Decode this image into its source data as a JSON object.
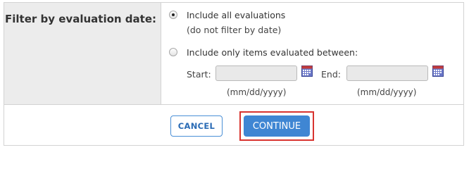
{
  "filter": {
    "label": "Filter by evaluation date:",
    "option_all": {
      "label": "Include all evaluations",
      "sublabel": "(do not filter by date)",
      "selected": true
    },
    "option_range": {
      "label": "Include only items evaluated between:",
      "selected": false,
      "start_label": "Start:",
      "end_label": "End:",
      "start_value": "",
      "end_value": "",
      "start_format": "(mm/dd/yyyy)",
      "end_format": "(mm/dd/yyyy)"
    },
    "icons": {
      "start_picker": "calendar-icon",
      "end_picker": "calendar-icon"
    }
  },
  "actions": {
    "cancel_label": "CANCEL",
    "continue_label": "CONTINUE",
    "highlight_color": "#d8332f",
    "primary_color": "#3f86d3"
  }
}
